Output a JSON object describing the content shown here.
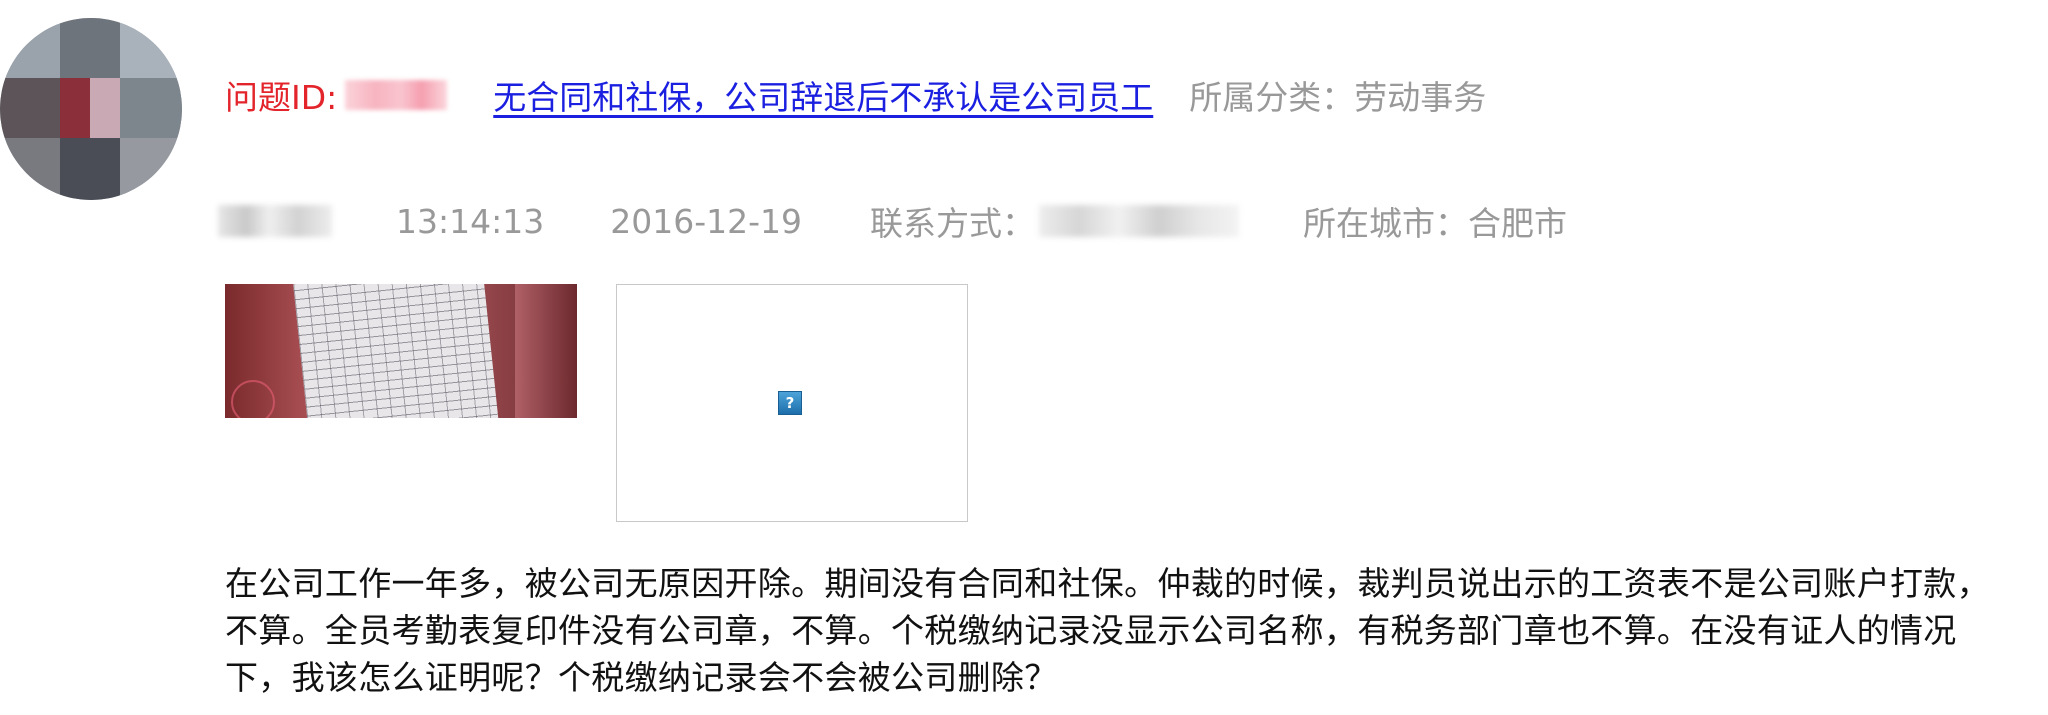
{
  "question": {
    "id_label": "问题ID:",
    "title": "无合同和社保，公司辞退后不承认是公司员工",
    "category": "所属分类：劳动事务"
  },
  "meta": {
    "time": "13:14:13",
    "date": "2016-12-19",
    "contact_label": "联系方式：",
    "city": "所在城市：合肥市"
  },
  "attachments": {
    "broken_icon_glyph": "?"
  },
  "description": "在公司工作一年多，被公司无原因开除。期间没有合同和社保。仲裁的时候，裁判员说出示的工资表不是公司账户打款，不算。全员考勤表复印件没有公司章，不算。个税缴纳记录没显示公司名称，有税务部门章也不算。在没有证人的情况下，我该怎么证明呢？个税缴纳记录会不会被公司删除？",
  "colors": {
    "id_label": "#e3242b",
    "link": "#1a1fe0",
    "muted": "#999999",
    "body_text": "#111111"
  }
}
